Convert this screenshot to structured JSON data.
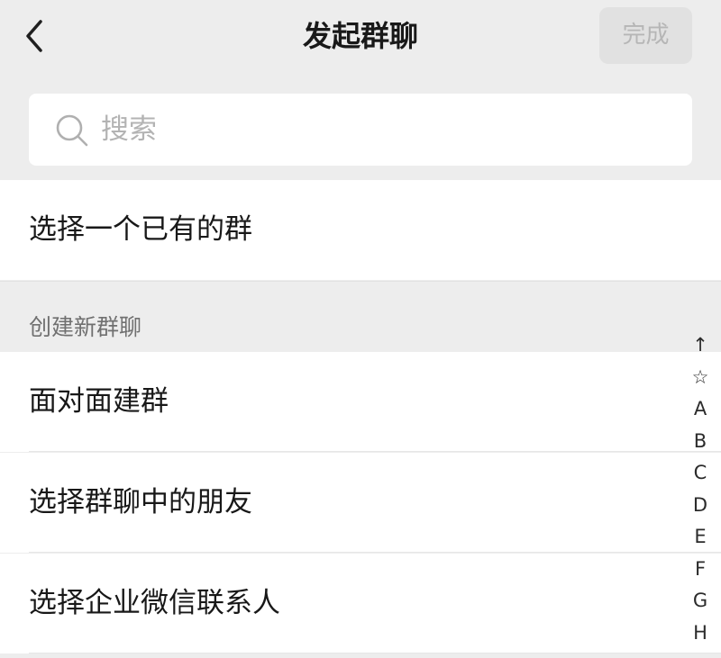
{
  "nav": {
    "title": "发起群聊",
    "done_label": "完成"
  },
  "search": {
    "placeholder": "搜索"
  },
  "existing_group": {
    "label": "选择一个已有的群"
  },
  "new_group": {
    "section_title": "创建新群聊",
    "items": [
      {
        "label": "面对面建群"
      },
      {
        "label": "选择群聊中的朋友"
      },
      {
        "label": "选择企业微信联系人"
      }
    ]
  },
  "index_bar": {
    "letters": [
      "↑",
      "☆",
      "A",
      "B",
      "C",
      "D",
      "E",
      "F",
      "G",
      "H"
    ]
  },
  "colors": {
    "page_background": "#ededed",
    "done_button_bg": "#e1e1e1",
    "done_button_text": "#b6b6b6",
    "placeholder": "#b3b3b3",
    "section_label": "#707070"
  },
  "icons": {
    "back": "chevron-left-icon",
    "search": "search-icon"
  }
}
